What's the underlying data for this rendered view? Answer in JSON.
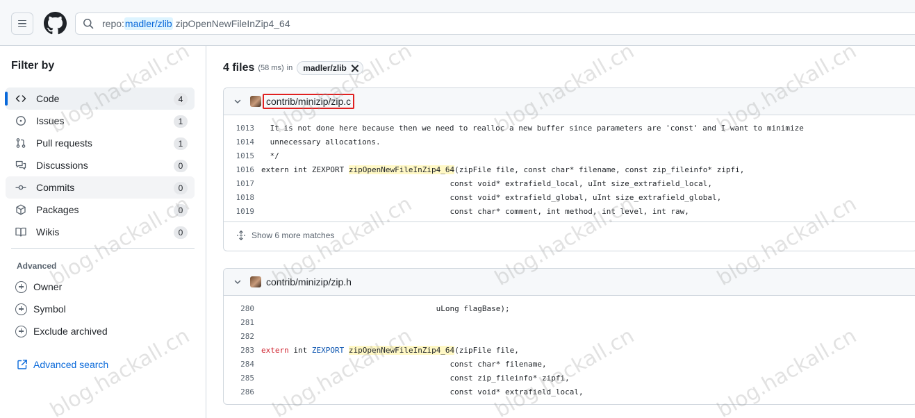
{
  "search": {
    "prefix": "repo:",
    "repo": "madler/zlib",
    "term": "zipOpenNewFileInZip4_64"
  },
  "sidebar": {
    "title": "Filter by",
    "items": [
      {
        "label": "Code",
        "count": "4",
        "icon": "code-icon"
      },
      {
        "label": "Issues",
        "count": "1",
        "icon": "issue-opened-icon"
      },
      {
        "label": "Pull requests",
        "count": "1",
        "icon": "git-pull-request-icon"
      },
      {
        "label": "Discussions",
        "count": "0",
        "icon": "comment-discussion-icon"
      },
      {
        "label": "Commits",
        "count": "0",
        "icon": "git-commit-icon"
      },
      {
        "label": "Packages",
        "count": "0",
        "icon": "package-icon"
      },
      {
        "label": "Wikis",
        "count": "0",
        "icon": "book-icon"
      }
    ],
    "advanced_title": "Advanced",
    "advanced": [
      {
        "label": "Owner"
      },
      {
        "label": "Symbol"
      },
      {
        "label": "Exclude archived"
      }
    ],
    "advanced_search_link": "Advanced search"
  },
  "results": {
    "count": "4 files",
    "time": "(58 ms)",
    "in": "in",
    "repo_chip": "madler/zlib"
  },
  "files": [
    {
      "path": "contrib/minizip/zip.c",
      "lines": [
        {
          "n": "1013",
          "pre": " It is not done here because then we need to realloc a new buffer since parameters are 'const' and I want to minimize",
          "match": "",
          "post": ""
        },
        {
          "n": "1014",
          "pre": " unnecessary allocations.",
          "match": "",
          "post": ""
        },
        {
          "n": "1015",
          "pre": " */",
          "match": "",
          "post": ""
        },
        {
          "n": "1016",
          "pre": "extern int ZEXPORT ",
          "match": "zipOpenNewFileInZip4_64",
          "post": "(zipFile file, const char* filename, const zip_fileinfo* zipfi,"
        },
        {
          "n": "1017",
          "pre": "                                         const void* extrafield_local, uInt size_extrafield_local,",
          "match": "",
          "post": ""
        },
        {
          "n": "1018",
          "pre": "                                         const void* extrafield_global, uInt size_extrafield_global,",
          "match": "",
          "post": ""
        },
        {
          "n": "1019",
          "pre": "                                         const char* comment, int method, int level, int raw,",
          "match": "",
          "post": ""
        }
      ],
      "more": "Show 6 more matches"
    },
    {
      "path": "contrib/minizip/zip.h",
      "lines": [
        {
          "n": "280",
          "pre": "                                      uLong flagBase);",
          "match": "",
          "post": ""
        },
        {
          "n": "281",
          "pre": "",
          "match": "",
          "post": ""
        },
        {
          "n": "282",
          "pre": "",
          "match": "",
          "post": ""
        },
        {
          "n": "283",
          "kw": "extern",
          "mid": " int ",
          "kw2": "ZEXPORT",
          "pre": " ",
          "match": "zipOpenNewFileInZip4_64",
          "post": "(zipFile file,"
        },
        {
          "n": "284",
          "pre": "                                         const char* filename,",
          "match": "",
          "post": ""
        },
        {
          "n": "285",
          "pre": "                                         const zip_fileinfo* zipfi,",
          "match": "",
          "post": ""
        },
        {
          "n": "286",
          "pre": "                                         const void* extrafield_local,",
          "match": "",
          "post": ""
        }
      ]
    }
  ],
  "watermark": "blog.hackall.cn",
  "colors": {
    "accent": "#0969da",
    "highlight": "#fff8c5",
    "annotation_box": "#e02020"
  }
}
